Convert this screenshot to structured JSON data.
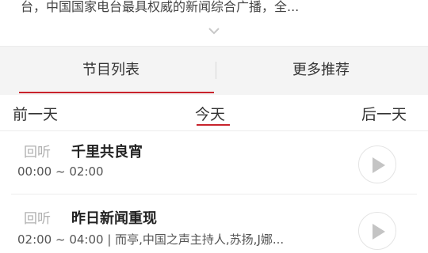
{
  "description_text": "台，中国国家电台最具权威的新闻综合广播，全...",
  "tabs": [
    {
      "label": "节目列表",
      "active": true
    },
    {
      "label": "更多推荐",
      "active": false
    }
  ],
  "days": {
    "prev": "前一天",
    "today": "今天",
    "next": "后一天"
  },
  "programs": [
    {
      "replay": "回听",
      "title": "千里共良宵",
      "time": "00:00 ~ 02:00"
    },
    {
      "replay": "回听",
      "title": "昨日新闻重现",
      "time": "02:00 ~ 04:00 | 而亭,中国之声主持人,苏扬,J娜..."
    }
  ],
  "colors": {
    "accent": "#c8232c",
    "tab_bg": "#f4f4f4"
  },
  "icons": {
    "expand": "chevron-down-icon",
    "play": "play-icon"
  }
}
